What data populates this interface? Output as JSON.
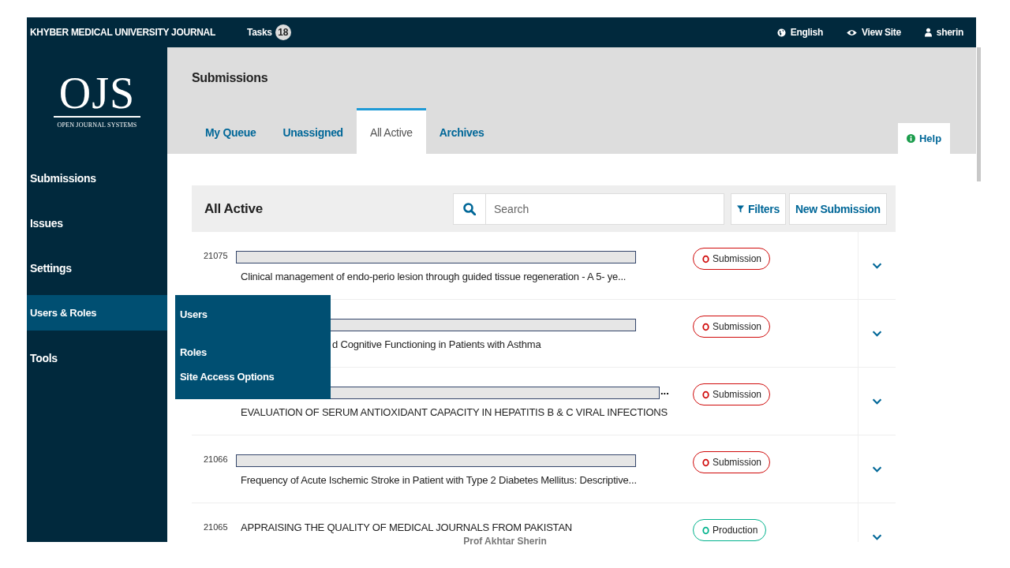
{
  "top_bar": {
    "site_title": "KHYBER MEDICAL UNIVERSITY JOURNAL",
    "tasks_label": "Tasks",
    "tasks_count": "18",
    "links": [
      {
        "kind": "language",
        "label": "English"
      },
      {
        "kind": "view",
        "label": "View Site"
      },
      {
        "kind": "user",
        "label": "sherin"
      }
    ]
  },
  "logo": {
    "mark": "OJS",
    "tagline": "OPEN JOURNAL SYSTEMS"
  },
  "sidebar": {
    "items": [
      {
        "label": "Submissions",
        "selected": false
      },
      {
        "label": "Issues",
        "selected": false
      },
      {
        "label": "Settings",
        "selected": false
      },
      {
        "label": "Users & Roles",
        "selected": true,
        "children": [
          {
            "label": "Users"
          },
          {
            "label": "Roles"
          },
          {
            "label": "Site Access Options"
          }
        ]
      },
      {
        "label": "Tools",
        "selected": false
      }
    ]
  },
  "page": {
    "title": "Submissions",
    "tabs": [
      {
        "label": "My Queue",
        "selected": false
      },
      {
        "label": "Unassigned",
        "selected": false
      },
      {
        "label": "All Active",
        "selected": true
      },
      {
        "label": "Archives",
        "selected": false
      }
    ],
    "help": "Help"
  },
  "list": {
    "title": "All Active",
    "search": {
      "placeholder": "Search"
    },
    "buttons": [
      {
        "kind": "filter",
        "label": "Filters"
      },
      {
        "kind": "plain",
        "label": "New Submission"
      }
    ],
    "rows": [
      {
        "id": "21075",
        "redacted": true,
        "title": "Clinical management of endo-perio lesion through guided tissue regeneration - A 5- ye...",
        "stage": {
          "label": "Submission",
          "color": "#d00a0a"
        }
      },
      {
        "redacted": true,
        "title": "d Cognitive Functioning in Patients with Asthma",
        "stage": {
          "label": "Submission",
          "color": "#d00a0a"
        }
      },
      {
        "redacted": true,
        "redaction_tail": "...",
        "title": "EVALUATION OF SERUM ANTIOXIDANT CAPACITY IN HEPATITIS B & C VIRAL INFECTIONS",
        "stage": {
          "label": "Submission",
          "color": "#d00a0a"
        }
      },
      {
        "id": "21066",
        "redacted": true,
        "title": "Frequency of Acute Ischemic Stroke in Patient with Type 2 Diabetes Mellitus: Descriptive...",
        "stage": {
          "label": "Submission",
          "color": "#d00a0a"
        }
      },
      {
        "id": "21065",
        "redacted": false,
        "title": "APPRAISING THE QUALITY OF MEDICAL JOURNALS FROM PAKISTAN",
        "stage": {
          "label": "Production",
          "color": "#00b28c"
        }
      }
    ]
  },
  "caption": "Prof Akhtar Sherin"
}
